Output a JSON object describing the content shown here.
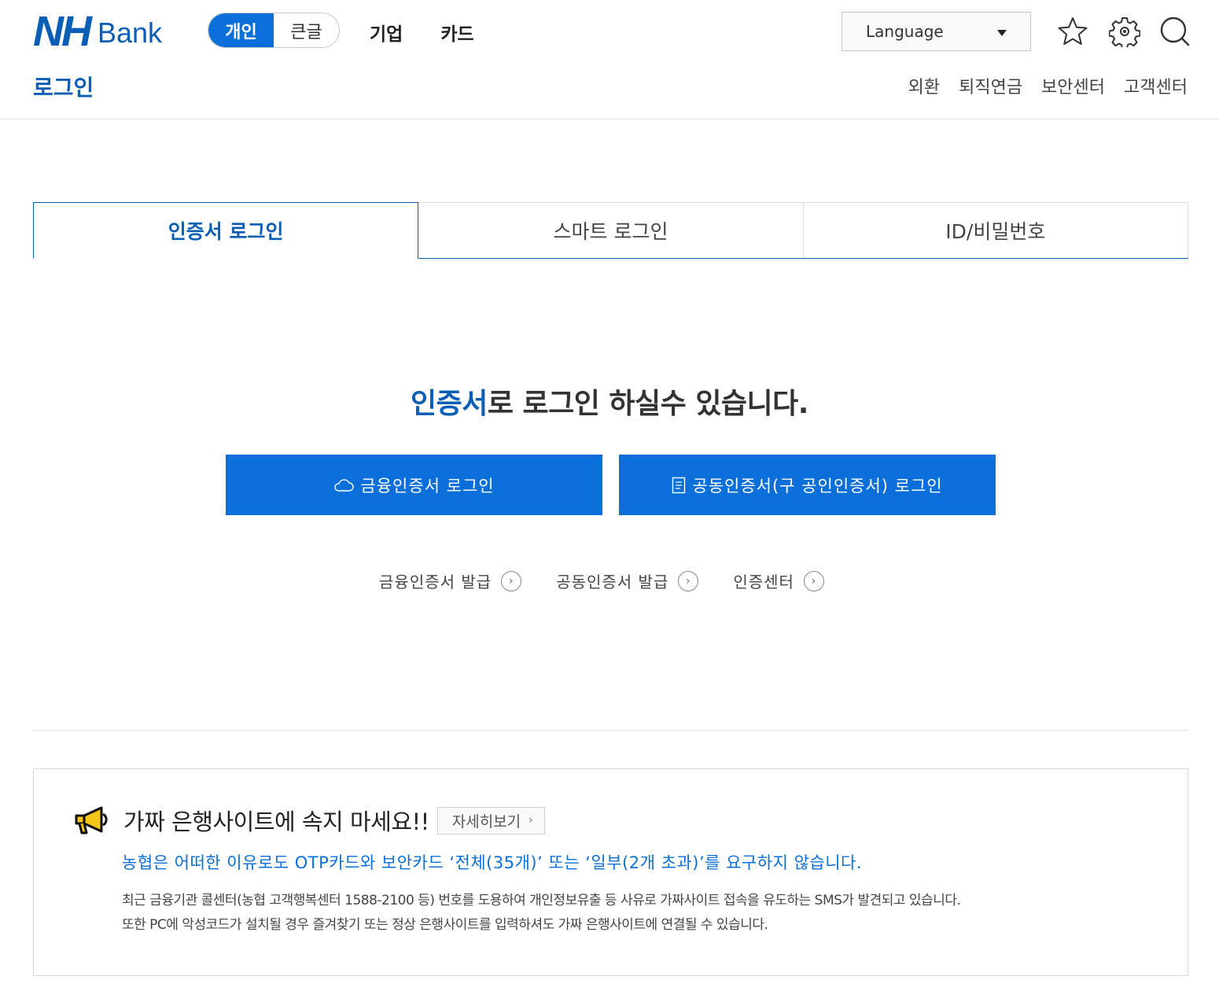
{
  "header": {
    "logo_nh": "NH",
    "logo_bank": "Bank",
    "mode_toggle": {
      "personal": "개인",
      "large_text": "큰글"
    },
    "nav": [
      "기업",
      "카드"
    ],
    "language": {
      "selected": "Language"
    },
    "page_title": "로그인",
    "sub_nav": [
      "외환",
      "퇴직연금",
      "보안센터",
      "고객센터"
    ]
  },
  "tabs": [
    "인증서 로그인",
    "스마트 로그인",
    "ID/비밀번호"
  ],
  "main": {
    "headline_accent": "인증서",
    "headline_rest": "로 로그인 하실수 있습니다.",
    "btn_financial": "금융인증서 로그인",
    "btn_joint": "공동인증서(구 공인인증서) 로그인",
    "links": [
      "금융인증서 발급",
      "공동인증서 발급",
      "인증센터"
    ]
  },
  "notice": {
    "title": "가짜 은행사이트에 속지 마세요!!",
    "detail_label": "자세히보기",
    "warning": "농협은 어떠한 이유로도 OTP카드와 보안카드 ‘전체(35개)’ 또는 ‘일부(2개 초과)’를 요구하지 않습니다.",
    "body_line1": "최근 금융기관 콜센터(농협 고객행복센터 1588-2100 등) 번호를 도용하여 개인정보유출 등 사유로 가짜사이트 접속을 유도하는 SMS가 발견되고 있습니다.",
    "body_line2": "또한 PC에 악성코드가 설치될 경우 즐겨찾기 또는 정상 은행사이트를 입력하셔도 가짜 은행사이트에 연결될 수 있습니다."
  },
  "colors": {
    "brand": "#0a5eb5",
    "button": "#0a6fd8"
  }
}
